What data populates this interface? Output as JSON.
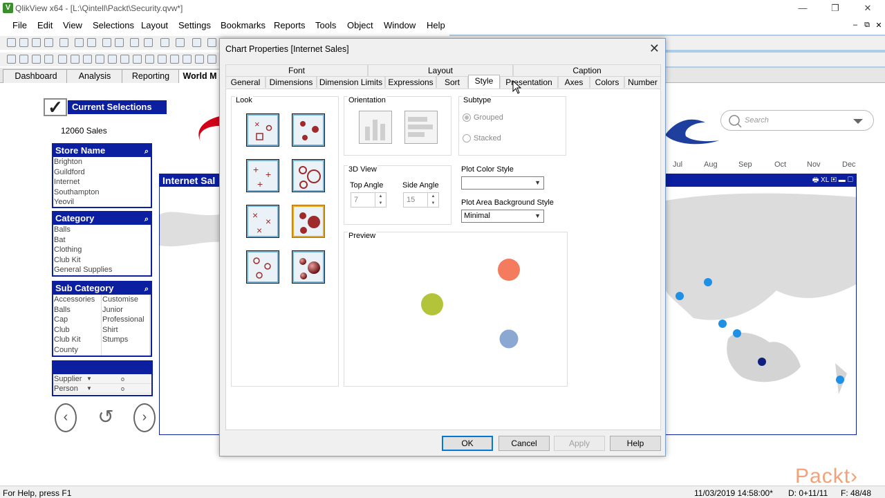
{
  "window": {
    "title": "QlikView x64 - [L:\\Qintell\\Packt\\Security.qvw*]",
    "app_icon": "V",
    "min": "—",
    "restore": "❐",
    "close": "✕"
  },
  "menu": [
    "File",
    "Edit",
    "View",
    "Selections",
    "Layout",
    "Settings",
    "Bookmarks",
    "Reports",
    "Tools",
    "Object",
    "Window",
    "Help"
  ],
  "mdi": {
    "min": "–",
    "restore": "⧉",
    "close": "✕"
  },
  "sheet_tabs": [
    {
      "label": "Dashboard"
    },
    {
      "label": "Analysis"
    },
    {
      "label": "Reporting"
    },
    {
      "label": "World M"
    }
  ],
  "current_selections": {
    "check": "✓",
    "label": "Current Selections",
    "sales": "12060 Sales"
  },
  "listboxes": {
    "store_name": {
      "title": "Store Name",
      "items": [
        "Brighton",
        "Guildford",
        "Internet",
        "Southampton",
        "Yeovil"
      ]
    },
    "category": {
      "title": "Category",
      "items": [
        "Balls",
        "Bat",
        "Clothing",
        "Club Kit",
        "General Supplies"
      ]
    },
    "sub_category": {
      "title": "Sub Category",
      "col1": [
        "Accessories",
        "Balls",
        "Cap",
        "Club",
        "Club Kit",
        "County"
      ],
      "col2": [
        "Customise",
        "Junior",
        "Professional",
        "Shirt",
        "Stumps",
        ""
      ]
    }
  },
  "multibox": {
    "rows": [
      {
        "label": "Supplier",
        "value": "o"
      },
      {
        "label": "Person",
        "value": "o"
      }
    ]
  },
  "nav": {
    "back": "‹",
    "reset": "↺",
    "forward": "›"
  },
  "background": {
    "chart_title": "Internet Sal",
    "months": [
      "Jul",
      "Aug",
      "Sep",
      "Oct",
      "Nov",
      "Dec"
    ],
    "search_placeholder": "Search",
    "map_toolbar": "🖶 XL ▣ ▬ ▢"
  },
  "dialog": {
    "title": "Chart Properties [Internet Sales]",
    "close": "✕",
    "top_tabs": [
      "Font",
      "Layout",
      "Caption"
    ],
    "tabs": [
      "General",
      "Dimensions",
      "Dimension Limits",
      "Expressions",
      "Sort",
      "Style",
      "Presentation",
      "Axes",
      "Colors",
      "Number"
    ],
    "active_tab": "Style",
    "look_label": "Look",
    "orientation_label": "Orientation",
    "subtype_label": "Subtype",
    "subtype_options": [
      "Grouped",
      "Stacked"
    ],
    "view3d_label": "3D View",
    "top_angle_label": "Top Angle",
    "top_angle_value": "7",
    "side_angle_label": "Side Angle",
    "side_angle_value": "15",
    "plot_color_style_label": "Plot Color Style",
    "plot_color_style_value": "",
    "plot_area_bg_label": "Plot Area Background Style",
    "plot_area_bg_value": "Minimal",
    "preview_label": "Preview",
    "preview_colors": {
      "orange": "#f47b5e",
      "green": "#b4c43a",
      "blue": "#8aa8d2"
    },
    "buttons": {
      "ok": "OK",
      "cancel": "Cancel",
      "apply": "Apply",
      "help": "Help"
    }
  },
  "statusbar": {
    "help": "For Help, press F1",
    "datetime": "11/03/2019 14:58:00*",
    "dims": "D: 0+11/11",
    "fields": "F: 48/48"
  },
  "watermark": "Packt›"
}
